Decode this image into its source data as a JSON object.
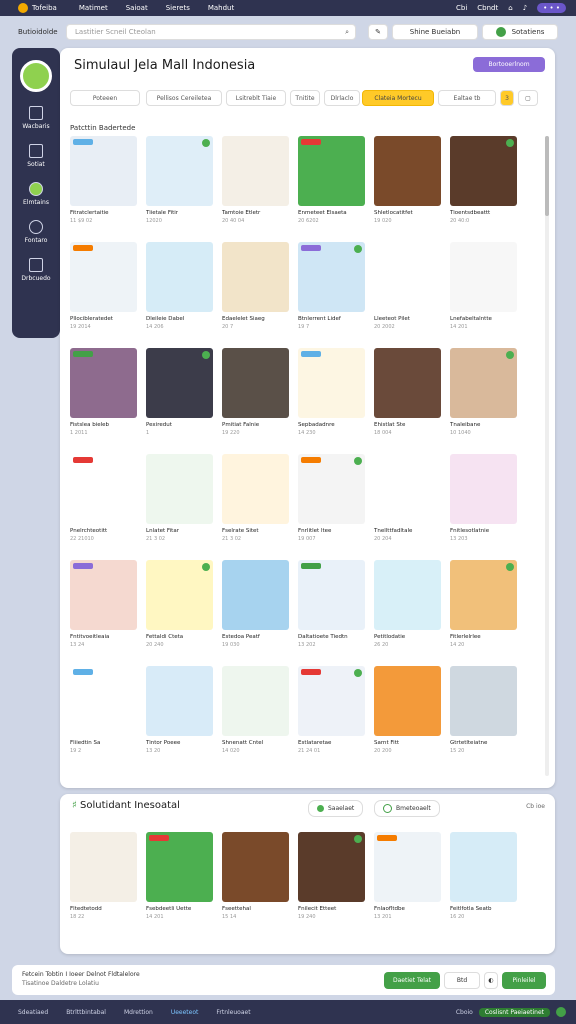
{
  "topbar": {
    "brand": "Tofeiba",
    "items": [
      "Matimet",
      "Saioat",
      "Sierets",
      "Mahdut"
    ],
    "right_items": [
      "Cbi",
      "Cbndt"
    ],
    "badge": "• • •"
  },
  "header": {
    "crumb": "Butioidolde",
    "search_placeholder": "Lastitier Scneil Cteolan",
    "btn2": "Shine Bueiabn",
    "btn3": "Sotatiens"
  },
  "sidebar": {
    "items": [
      "Wacbaris",
      "Sotiat",
      "Elmtains",
      "Fontaro",
      "Drbcuedo"
    ]
  },
  "panel": {
    "title": "Simulaul Jela Mall Indonesia",
    "purple_button": "Bortooerlnom",
    "filters": [
      "Poteeen",
      "Pellisos Cereiletea",
      "Lsitreblt Tiaie",
      "Tnitite",
      "Dlrlaclo",
      "Clateia Mortecu",
      "Ealtae tb",
      "3",
      "▢"
    ],
    "section_label": "Patcttin Badertede",
    "cards": [
      {
        "name": "Fitratclertaitie",
        "meta": "11 $9 02"
      },
      {
        "name": "Tiietale Fitir",
        "meta": "12020"
      },
      {
        "name": "Tamtoie Etletr",
        "meta": "20 40 04"
      },
      {
        "name": "Enmeteet Elsaeta",
        "meta": "20 6202"
      },
      {
        "name": "Shletlocatitfet",
        "meta": "19 020"
      },
      {
        "name": "Tioentsdbeattt",
        "meta": "20 40:0"
      },
      {
        "name": "Pllocibleratedet",
        "meta": "19 2014"
      },
      {
        "name": "Dleileie Dabel",
        "meta": "14 206"
      },
      {
        "name": "Edaelelet Siaeg",
        "meta": "20 7"
      },
      {
        "name": "Btnlerrent Lidef",
        "meta": "19 7"
      },
      {
        "name": "Lleeteot Pilet",
        "meta": "20 2002"
      },
      {
        "name": "Lnefabeltalntte",
        "meta": "14 201"
      },
      {
        "name": "Fistslea bieleb",
        "meta": "1 2011"
      },
      {
        "name": "Pexiredut",
        "meta": "1"
      },
      {
        "name": "Pmitiat Falnie",
        "meta": "19 220"
      },
      {
        "name": "Sepbadadnre",
        "meta": "14 230"
      },
      {
        "name": "Ehistlat Ste",
        "meta": "18 004"
      },
      {
        "name": "Tnaleibane",
        "meta": "10 1040"
      },
      {
        "name": "Pnelrchteotitt",
        "meta": "22 21010"
      },
      {
        "name": "Lnlatet Fitar",
        "meta": "21 3 02"
      },
      {
        "name": "Fselrate Sitet",
        "meta": "21 3 02"
      },
      {
        "name": "Fnrlitlet ltee",
        "meta": "19 007"
      },
      {
        "name": "Tnellttfadltale",
        "meta": "20 204"
      },
      {
        "name": "Fnitlesotlatnie",
        "meta": "13 203"
      },
      {
        "name": "Fntitvoeitleaia",
        "meta": "13 24"
      },
      {
        "name": "Fettaldi Cteta",
        "meta": "20 240"
      },
      {
        "name": "Estedoa Peatf",
        "meta": "19 030"
      },
      {
        "name": "Daltatioete Tiedtn",
        "meta": "13 202"
      },
      {
        "name": "Petitlodatie",
        "meta": "26 20"
      },
      {
        "name": "Fitlerlelrlee",
        "meta": "14 20"
      },
      {
        "name": "Fliiedtin Sa",
        "meta": "19 2"
      },
      {
        "name": "Tintor Poeee",
        "meta": "13 20"
      },
      {
        "name": "Shnenatt Cntel",
        "meta": "14 020"
      },
      {
        "name": "Estlataretae",
        "meta": "21 24 01"
      },
      {
        "name": "Sarnt Fitt",
        "meta": "20 200"
      },
      {
        "name": "Gtrtetlteiatne",
        "meta": "15 20"
      }
    ]
  },
  "panel2": {
    "title": "Solutidant Inesoatal",
    "btn1": "Saaelaet",
    "btn2": "Bmeteoaelt",
    "link": "Cb ioe",
    "cards": [
      {
        "name": "Fltedtetodd",
        "meta": "18 22"
      },
      {
        "name": "Fsebdeetli Uette",
        "meta": "14 201"
      },
      {
        "name": "Fseettehal",
        "meta": "15 14"
      },
      {
        "name": "Fnilecit Etteet",
        "meta": "19 240"
      },
      {
        "name": "Fnlaofltdbe",
        "meta": "13 201"
      },
      {
        "name": "Feitlfotla Seatb",
        "meta": "16 20"
      }
    ]
  },
  "status": {
    "line1": "Fetcein Tobtin I Ioeer Delnot Fldtalelore",
    "line2": "Tisatinoe Daldetre Lolatiu",
    "btn1": "Daetiet Telat",
    "btn2": "Btd",
    "btn3": "Pinleilel"
  },
  "footer": {
    "items": [
      "Sdeatiaed",
      "Btrlttbintabal",
      "Mdrettion",
      "Ueeeteot",
      "Frtnleuoaet"
    ],
    "right": [
      "Cboio",
      "Coslisnt Paeiaetinet"
    ]
  },
  "colors": {
    "dark": "#2f3350",
    "accent_yellow": "#ffca28",
    "accent_green": "#43a047",
    "accent_purple": "#8b6cd8"
  }
}
